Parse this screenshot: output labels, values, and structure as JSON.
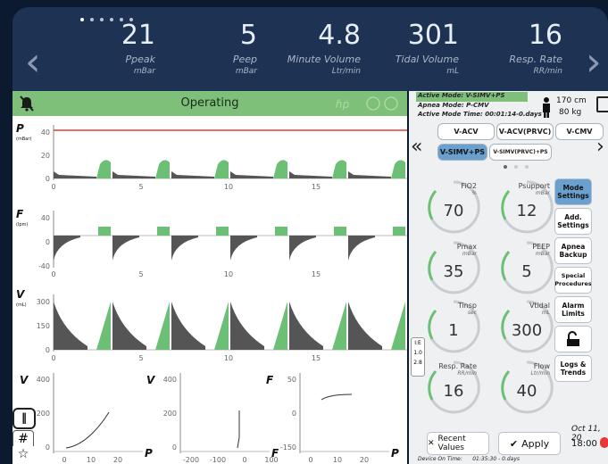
{
  "header": {
    "metrics": [
      {
        "value": "21",
        "label": "Ppeak",
        "unit": "mBar"
      },
      {
        "value": "5",
        "label": "Peep",
        "unit": "mBar"
      },
      {
        "value": "4.8",
        "label": "Minute Volume",
        "unit": "Ltr/min"
      },
      {
        "value": "301",
        "label": "Tidal Volume",
        "unit": "mL"
      },
      {
        "value": "16",
        "label": "Resp. Rate",
        "unit": "RR/min"
      }
    ],
    "page_dots": 6,
    "active_dot": 0
  },
  "status": {
    "text": "Operating",
    "bar_color": "#7ec07a"
  },
  "graphs": {
    "pressure": {
      "label": "P",
      "unit": "(mBar)",
      "yticks": [
        "40",
        "20",
        "0"
      ],
      "xticks": [
        "0",
        "5",
        "10",
        "15"
      ]
    },
    "flow": {
      "label": "F",
      "unit": "(lpm)",
      "yticks": [
        "40",
        "0",
        "-40"
      ],
      "xticks": [
        "0",
        "5",
        "10",
        "15"
      ]
    },
    "volume": {
      "label": "V",
      "unit": "(mL)",
      "yticks": [
        "300",
        "150",
        "0"
      ],
      "xticks": [
        "0",
        "5",
        "10",
        "15"
      ]
    },
    "loops": [
      {
        "ylabel": "V",
        "xlabel": "P",
        "yticks": [
          "400",
          "200",
          "0"
        ],
        "xticks": [
          "0",
          "10",
          "20"
        ]
      },
      {
        "ylabel": "V",
        "xlabel": "F",
        "yticks": [
          "400",
          "200",
          "0"
        ],
        "xticks": [
          "-200",
          "-100",
          "0",
          "100"
        ]
      },
      {
        "ylabel": "F",
        "xlabel": "P",
        "yticks": [
          "50",
          "0",
          "-150"
        ],
        "xticks": [
          "0",
          "10",
          "20"
        ]
      }
    ]
  },
  "mode_info": {
    "active_mode": "Active Mode: V-SIMV+PS",
    "apnea_mode": "Apnea Mode:   P-CMV",
    "active_time": "Active Mode Time:  00:01:14-0.days",
    "height": "170",
    "height_unit": "cm",
    "weight": "80",
    "weight_unit": "kg"
  },
  "modes": [
    {
      "label": "V-ACV",
      "selected": false
    },
    {
      "label": "V-ACV(PRVC)",
      "selected": false
    },
    {
      "label": "V-CMV",
      "selected": false
    },
    {
      "label": "V-SIMV+PS",
      "selected": true
    },
    {
      "label": "V-SIMV(PRVC)+PS",
      "selected": false
    }
  ],
  "settings": [
    {
      "name": "FiO2",
      "unit": "%",
      "value": "70"
    },
    {
      "name": "Psupport",
      "unit": "mBar",
      "value": "12"
    },
    {
      "name": "Pmax",
      "unit": "mBar",
      "value": "35"
    },
    {
      "name": "PEEP",
      "unit": "mBar",
      "value": "5"
    },
    {
      "name": "Tinsp",
      "unit": "sec",
      "value": "1"
    },
    {
      "name": "Vtidal",
      "unit": "mL",
      "value": "300"
    },
    {
      "name": "Resp. Rate",
      "unit": "RR/min",
      "value": "16"
    },
    {
      "name": "Flow",
      "unit": "Ltr/min",
      "value": "40"
    }
  ],
  "ie_ratio": {
    "label": "I:E",
    "i": "1.0",
    "e": "2.8"
  },
  "side_buttons": [
    "Mode Settings",
    "Add. Settings",
    "Apnea Backup",
    "Special Procedures",
    "Alarm Limits",
    "",
    "Logs & Trends"
  ],
  "bottom": {
    "recent_values": "Recent Values",
    "apply": "Apply",
    "date": "Oct 11, 20",
    "time": "18:00",
    "device_on_time": "Device On Time:",
    "device_on_value": "01:35:30 - 0.days"
  },
  "colors": {
    "accent_green": "#6dbf76",
    "selected_blue": "#6aa0cf",
    "ppeak_line": "#e53935"
  }
}
